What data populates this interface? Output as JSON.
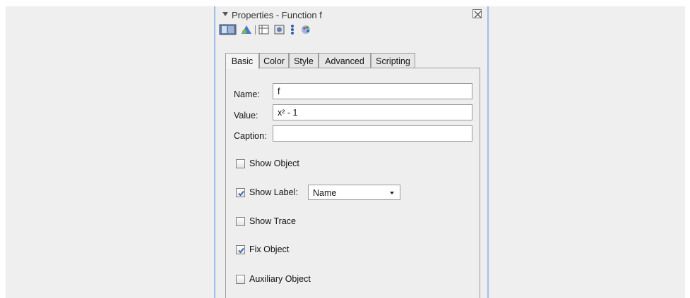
{
  "panel": {
    "title": "Properties - Function f",
    "toolbar_icons": [
      "graphics-view-icon",
      "algebra-icon",
      "table-icon",
      "object-icon",
      "point-icon",
      "palette-icon"
    ]
  },
  "tabs": [
    {
      "label": "Basic",
      "active": true
    },
    {
      "label": "Color",
      "active": false
    },
    {
      "label": "Style",
      "active": false
    },
    {
      "label": "Advanced",
      "active": false
    },
    {
      "label": "Scripting",
      "active": false
    }
  ],
  "basic": {
    "name_label": "Name:",
    "name_value": "f",
    "value_label": "Value:",
    "value_value": "x² - 1",
    "caption_label": "Caption:",
    "caption_value": "",
    "show_object": {
      "label": "Show Object",
      "checked": false
    },
    "show_label": {
      "label": "Show Label:",
      "checked": true,
      "selected": "Name"
    },
    "show_trace": {
      "label": "Show Trace",
      "checked": false
    },
    "fix_object": {
      "label": "Fix Object",
      "checked": true
    },
    "auxiliary_object": {
      "label": "Auxiliary Object",
      "checked": false
    }
  },
  "colors": {
    "panel_border": "#9fbde8",
    "background": "#eeeeee",
    "check_mark": "#2a5db0"
  }
}
